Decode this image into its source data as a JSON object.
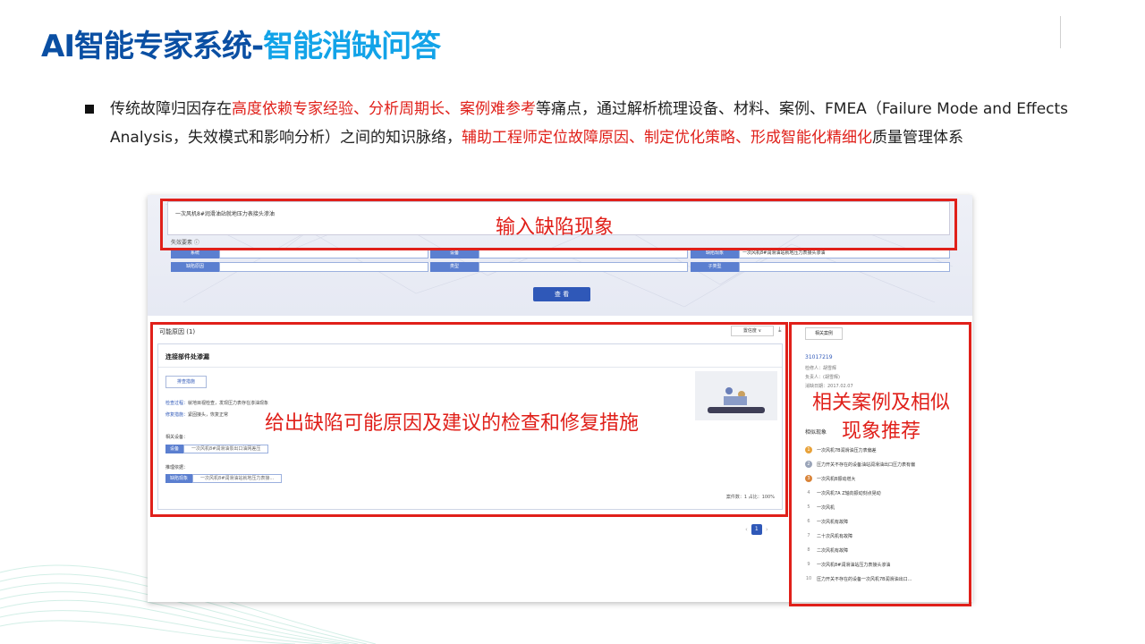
{
  "title": {
    "part1": "AI智能专家系统-",
    "part2": "智能消缺问答"
  },
  "bullet": {
    "s1": "传统故障归因存在",
    "s2_red": "高度依赖专家经验、分析周期长、案例难参考",
    "s3": "等痛点，通过解析梳理设备、材料、案例、FMEA（Failure Mode and Effects Analysis，失效模式和影响分析）之间的知识脉络，",
    "s4_red": "辅助工程师定位故障原因、制定优化策略、形成智能化精细化",
    "s5": "质量管理体系"
  },
  "screenshot": {
    "query_text": "一次风机8#润滑油站就地压力表接头渗油",
    "fail_elements_label": "失效要素 ⓘ",
    "fields": [
      {
        "label": "系统",
        "value": ""
      },
      {
        "label": "设备",
        "value": ""
      },
      {
        "label": "缺陷现象",
        "value": "一次风机8#润滑油站就地压力表接头渗油"
      },
      {
        "label": "缺陷原因",
        "value": ""
      },
      {
        "label": "类型",
        "value": ""
      },
      {
        "label": "子类型",
        "value": ""
      }
    ],
    "search_button": "查 看",
    "cause_title": "可能原因 (1)",
    "sort_label": "置信度 ∨",
    "card": {
      "title": "连接部件处渗漏",
      "check_button": "排查措施",
      "check_process": "检查过程：",
      "check_process_val": "就地目视检查，发现压力表存在渗油现象",
      "repair": "修复措施：",
      "repair_val": "紧固接头，恢复正常",
      "related_equip": "相关设备：",
      "equip_tag": "设备",
      "equip_val": "一次风机8#润滑油泵出口油网差压",
      "reasoning": "推理依据：",
      "reason_tag": "缺陷现象",
      "reason_val": "一次风机8#润滑油站就地压力表接...",
      "stat": "案件数：1   占比：100%"
    },
    "page_num": "1",
    "side": {
      "related_cases_btn": "相关案例",
      "case_id": "31017219",
      "case_lines": [
        "检修人：胡雪辉",
        "负责人：(胡雪辉)",
        "消缺日期：2017.02.07"
      ],
      "similar_title": "相似现象",
      "similar": [
        {
          "n": "1",
          "t": "一次风机7B润滑油压力表偏差"
        },
        {
          "n": "2",
          "t": "压力开关不存在的设备油站润滑油出口压力表有偏"
        },
        {
          "n": "3",
          "t": "一次风机B振动增大"
        },
        {
          "n": "4",
          "t": "一次风机7A Z轴向振动刻点晃动"
        },
        {
          "n": "5",
          "t": "一次风机"
        },
        {
          "n": "6",
          "t": "一次风机有故障"
        },
        {
          "n": "7",
          "t": "二十次风机有故障"
        },
        {
          "n": "8",
          "t": "二次风机有故障"
        },
        {
          "n": "9",
          "t": "一次风机8#润滑油站压力表接头渗油"
        },
        {
          "n": "10",
          "t": "压力开关不存在的设备一次风机7B润滑油出口..."
        }
      ]
    }
  },
  "annotations": {
    "input": "输入缺陷现象",
    "causes": "给出缺陷可能原因及建议的检查和修复措施",
    "related_l1": "相关案例及相似",
    "related_l2": "现象推荐"
  },
  "colors": {
    "title_dark": "#0a4fa3",
    "title_light": "#12a3e8",
    "annotation_red": "#e0201a",
    "primary_blue": "#2f58b8"
  }
}
